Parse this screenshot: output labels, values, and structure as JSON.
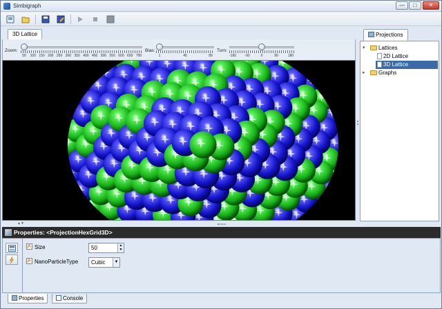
{
  "window": {
    "title": "Simbigraph",
    "minimize": "—",
    "maximize": "□",
    "close": "✕"
  },
  "toolbar": {
    "icons": [
      "new-icon",
      "open-icon",
      "save-icon",
      "save-as-icon",
      "play-icon",
      "stop-icon",
      "record-icon"
    ]
  },
  "left_tabs": [
    {
      "label": "3D Lattice",
      "active": true
    }
  ],
  "sliders": {
    "zoom": {
      "label": "Zoom:",
      "ticks": [
        "50",
        "100",
        "150",
        "200",
        "250",
        "300",
        "350",
        "400",
        "450",
        "500",
        "550",
        "600",
        "650",
        "700"
      ],
      "value": 50,
      "min": 50,
      "max": 700
    },
    "bias": {
      "label": "Bias:",
      "ticks": [
        "1",
        "45",
        "89"
      ],
      "value": 1,
      "min": 1,
      "max": 89
    },
    "turn": {
      "label": "Turn:",
      "ticks": [
        "-180",
        "-90",
        "0",
        "90",
        "180"
      ],
      "value": 0,
      "min": -180,
      "max": 180
    }
  },
  "right_tabs": [
    {
      "label": "Projections",
      "active": true
    }
  ],
  "tree": {
    "items": [
      {
        "label": "Lattices",
        "level": 0,
        "expanded": true,
        "folder": true
      },
      {
        "label": "2D Lattice",
        "level": 1,
        "folder": false
      },
      {
        "label": "3D Lattice",
        "level": 1,
        "folder": false,
        "selected": true
      },
      {
        "label": "Graphs",
        "level": 0,
        "expanded": false,
        "folder": true
      }
    ]
  },
  "properties": {
    "header": "Properties: <ProjectionHexGrid3D>",
    "rows": [
      {
        "name": "Size",
        "value": "50",
        "control": "spinner"
      },
      {
        "name": "NanoParticleType",
        "value": "Cubic",
        "control": "select"
      }
    ]
  },
  "bottom_tabs": [
    {
      "label": "Properties",
      "active": true,
      "icon": "properties-icon"
    },
    {
      "label": "Console",
      "active": false,
      "icon": "console-icon"
    }
  ],
  "colors": {
    "sphere_blue": "#1414d8",
    "sphere_green": "#22d022",
    "background": "#000000"
  }
}
